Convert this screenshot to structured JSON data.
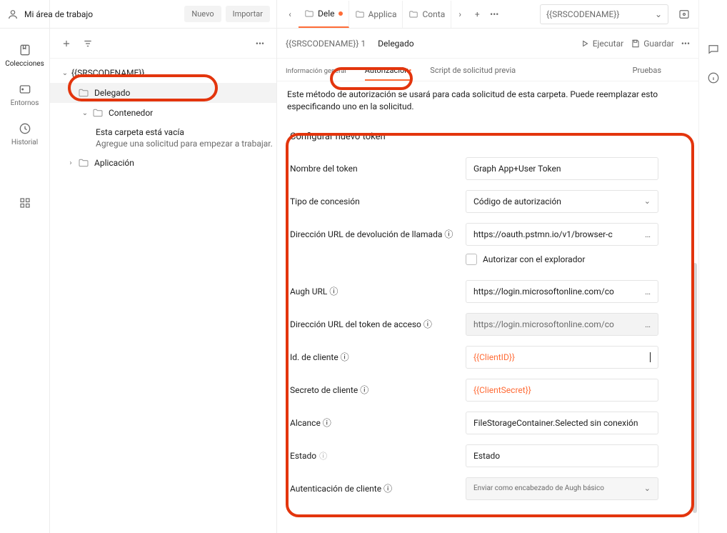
{
  "workspace": {
    "title": "Mi área de trabajo",
    "new_btn": "Nuevo",
    "import_btn": "Importar"
  },
  "rail": {
    "collections": "Colecciones",
    "environments": "Entornos",
    "history": "Historial"
  },
  "tree": {
    "root": "{{SRSCODENAME}}",
    "delegado": "Delegado",
    "contenedor": "Contenedor",
    "empty_title": "Esta carpeta está vacía",
    "empty_sub": "Agregue una solicitud para empezar a trabajar.",
    "aplicacion": "Aplicación"
  },
  "tabs": {
    "t1": "Dele",
    "t2": "Applica",
    "t3": "Conta"
  },
  "env": {
    "name": "{{SRSCODENAME}}"
  },
  "breadcrumb": {
    "part1": "{{SRSCODENAME}} 1",
    "current": "Delegado"
  },
  "actions": {
    "run": "Ejecutar",
    "save": "Guardar"
  },
  "subtabs": {
    "general": "Información general",
    "auth": "Autorización",
    "prereq": "Script de solicitud previa",
    "tests": "Pruebas"
  },
  "desc": "Este método de autorización se usará para cada solicitud de esta carpeta. Puede reemplazar esto especificando uno en la solicitud.",
  "form": {
    "title": "Configurar nuevo token",
    "token_name_label": "Nombre del token",
    "token_name_value": "Graph App+User Token",
    "grant_label": "Tipo de concesión",
    "grant_value": "Código de autorización",
    "callback_label": "Dirección URL de devolución de llamada ⓘ",
    "callback_value": "https://oauth.pstmn.io/v1/browser-c",
    "authorize_browser": "Autorizar con el explorador",
    "auth_url_label": "Augh URL ⓘ",
    "auth_url_value": "https://login.microsoftonline.com/co",
    "access_token_label": "Dirección URL del token de acceso ⓘ",
    "access_token_value": "https://login.microsoftonline.com/co",
    "client_id_label": "Id. de cliente ⓘ",
    "client_id_value": "{{ClientID}}",
    "client_secret_label": "Secreto de cliente ⓘ",
    "client_secret_value": "{{ClientSecret}}",
    "scope_label": "Alcance ⓘ",
    "scope_value": "FileStorageContainer.Selected sin conexión",
    "state_label": "Estado",
    "state_value": "Estado",
    "client_auth_label": "Autenticación de cliente ⓘ",
    "client_auth_value": "Enviar como encabezado de Augh básico"
  }
}
